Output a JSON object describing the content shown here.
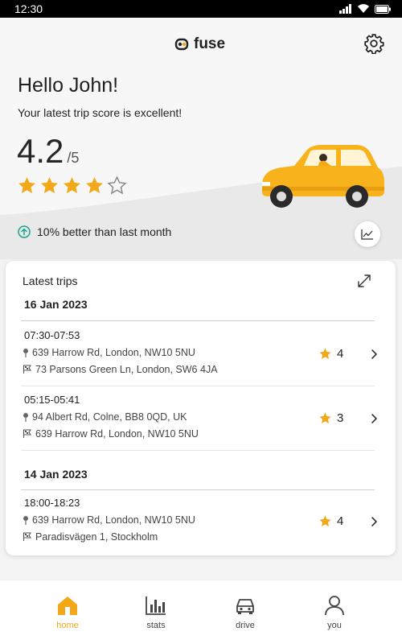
{
  "status_bar": {
    "time": "12:30"
  },
  "header": {
    "brand": "fuse"
  },
  "greeting": "Hello John!",
  "subtitle": "Your latest trip score is excellent!",
  "score": {
    "value": "4.2",
    "max": "/5",
    "rating": 4,
    "out_of": 5
  },
  "trend": {
    "text": "10% better than last month"
  },
  "latest_trips": {
    "title": "Latest trips",
    "groups": [
      {
        "date": "16 Jan 2023",
        "trips": [
          {
            "time": "07:30-07:53",
            "from": "639 Harrow Rd, London, NW10 5NU",
            "to": "73 Parsons Green Ln, London, SW6 4JA",
            "score": "4"
          },
          {
            "time": "05:15-05:41",
            "from": "94 Albert Rd, Colne, BB8 0QD, UK",
            "to": "639 Harrow Rd, London, NW10 5NU",
            "score": "3"
          }
        ]
      },
      {
        "date": "14 Jan 2023",
        "trips": [
          {
            "time": "18:00-18:23",
            "from": "639 Harrow Rd, London, NW10 5NU",
            "to": "Paradisvägen 1, Stockholm",
            "score": "4"
          }
        ]
      }
    ]
  },
  "nav": [
    {
      "label": "home",
      "icon": "home-icon",
      "active": true
    },
    {
      "label": "stats",
      "icon": "stats-icon",
      "active": false
    },
    {
      "label": "drive",
      "icon": "car-icon",
      "active": false
    },
    {
      "label": "you",
      "icon": "user-icon",
      "active": false
    }
  ],
  "colors": {
    "accent": "#f2a818",
    "car": "#f8b21c",
    "trend": "#19a58a"
  }
}
